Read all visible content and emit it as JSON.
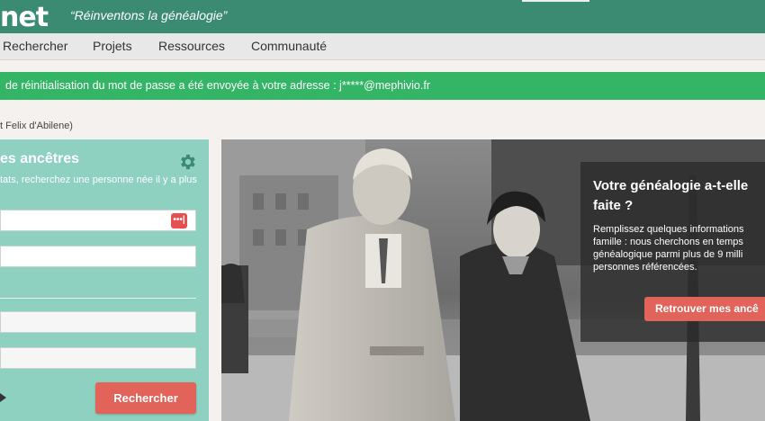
{
  "header": {
    "logo": "net",
    "tagline": "“Réinventons la généalogie”"
  },
  "nav": {
    "items": [
      "Rechercher",
      "Projets",
      "Ressources",
      "Communauté"
    ]
  },
  "alert": {
    "message": "de réinitialisation du mot de passe a été envoyée à votre adresse : j*****@mephivio.fr"
  },
  "breadcrumb": {
    "text": "t Felix d'Abilene)"
  },
  "search_panel": {
    "title": "es ancêtres",
    "subtitle": "tats, recherchez une personne née il y a plus",
    "keyboard_icon_label": "•••|",
    "search_button": "Rechercher",
    "icons": {
      "gear": "gear-icon",
      "keyboard": "keyboard-icon",
      "toggle": "play-icon"
    }
  },
  "hero": {
    "title": "Votre généalogie a-t-elle faite ?",
    "text": "Remplissez quelques informations famille : nous cherchons en temps généalogique parmi plus de 9 milli personnes référencées.",
    "button": "Retrouver mes ancê"
  },
  "colors": {
    "brand_green": "#3b8b72",
    "alert_green": "#33b565",
    "panel_teal": "#8ed1c1",
    "accent_red": "#e2635a"
  }
}
